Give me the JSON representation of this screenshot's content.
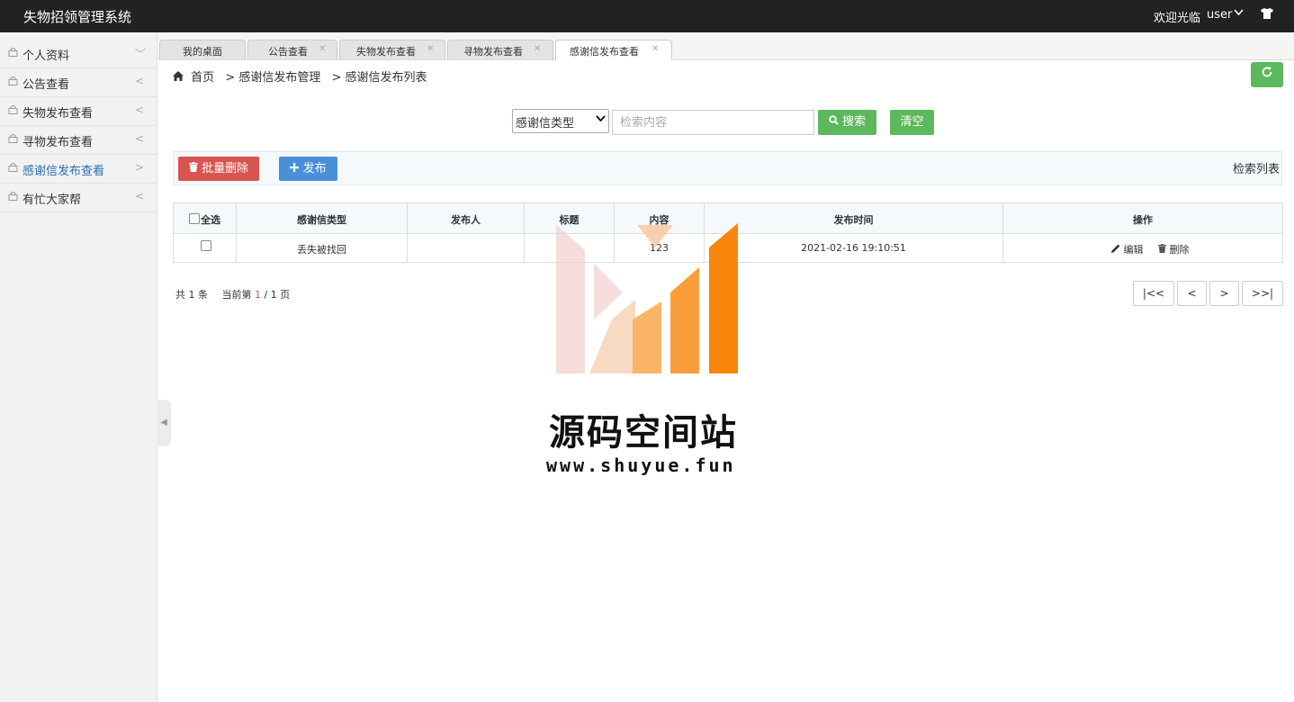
{
  "app": {
    "title": "失物招领管理系统",
    "welcome": "欢迎光临",
    "user": "user"
  },
  "sidebar": {
    "items": [
      {
        "label": "个人资料",
        "arrow": "﹀"
      },
      {
        "label": "公告查看",
        "arrow": "<"
      },
      {
        "label": "失物发布查看",
        "arrow": "<"
      },
      {
        "label": "寻物发布查看",
        "arrow": "<"
      },
      {
        "label": "感谢信发布查看",
        "arrow": ">"
      },
      {
        "label": "有忙大家帮",
        "arrow": "<"
      }
    ]
  },
  "tabs": [
    {
      "label": "我的桌面"
    },
    {
      "label": "公告查看"
    },
    {
      "label": "失物发布查看"
    },
    {
      "label": "寻物发布查看"
    },
    {
      "label": "感谢信发布查看"
    }
  ],
  "breadcrumb": {
    "home": "首页",
    "level1": "> 感谢信发布管理",
    "level2": "> 感谢信发布列表"
  },
  "search": {
    "select_value": "感谢信类型",
    "placeholder": "检索内容",
    "search_label": "搜索",
    "clear_label": "清空"
  },
  "toolbar": {
    "batch_delete": "批量删除",
    "publish": "发布",
    "right_label": "检索列表"
  },
  "table": {
    "headers": [
      "全选",
      "感谢信类型",
      "发布人",
      "标题",
      "内容",
      "发布时间",
      "操作"
    ],
    "rows": [
      {
        "type": "丢失被找回",
        "publisher": "",
        "title": "",
        "content": "123",
        "time": "2021-02-16 19:10:51",
        "edit": "编辑",
        "delete": "删除"
      }
    ]
  },
  "pager": {
    "total_prefix": "共",
    "total": "1",
    "total_suffix": "条",
    "current_prefix": "当前第",
    "current": "1",
    "sep": "/",
    "pages": "1",
    "pages_suffix": "页",
    "first": "|<<",
    "prev": "<",
    "next": ">",
    "last": ">>|"
  },
  "watermark": {
    "name": "源码空间站",
    "url": "www.shuyue.fun"
  },
  "colors": {
    "topbar": "#222222",
    "green": "#5cb85c",
    "red": "#d9534f",
    "blue": "#4a90d9",
    "active_link": "#2a6fb0"
  }
}
